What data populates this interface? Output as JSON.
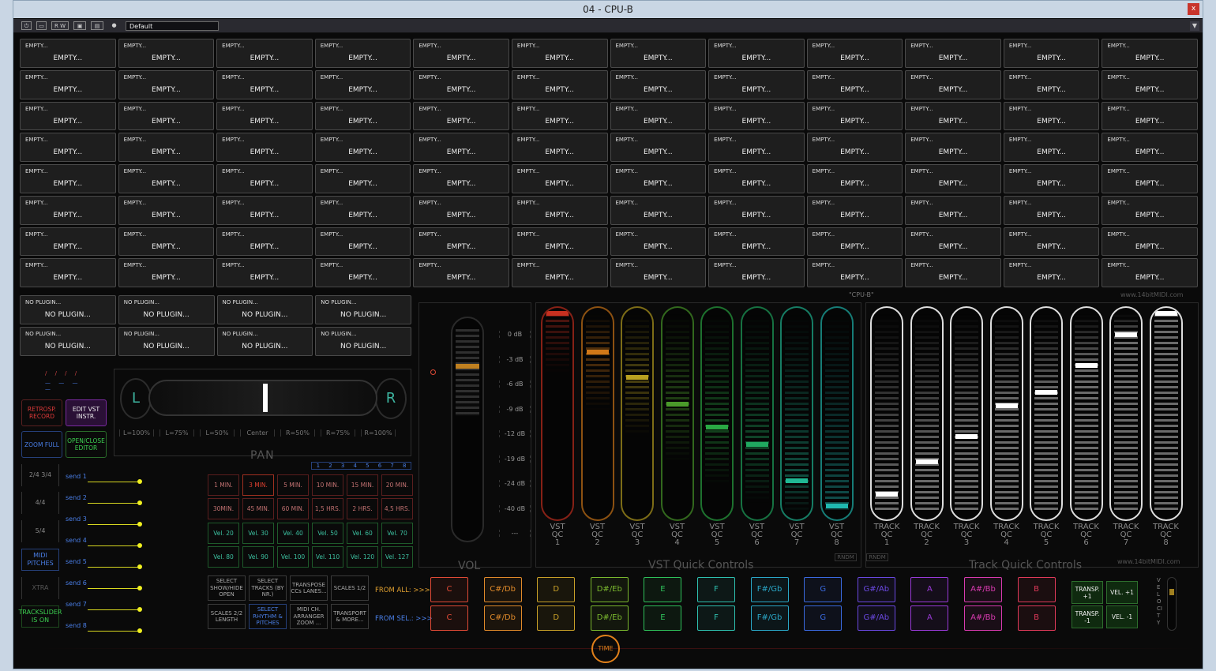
{
  "window": {
    "title": "04 - CPU-B",
    "close_label": "x"
  },
  "toolbar": {
    "buttons": [
      "⏻",
      "▭",
      "R W",
      "▣",
      "▤",
      "●"
    ],
    "preset": "Default"
  },
  "slots": {
    "top": "EMPTY...",
    "main": "EMPTY..."
  },
  "plugins": {
    "top": "NO PLUGIN...",
    "main": "NO PLUGIN..."
  },
  "left_buttons": {
    "retrosp": "RETROSP. RECORD",
    "edit_vst": "EDIT VST INSTR.",
    "zoom": "ZOOM FULL",
    "open_close": "OPEN/CLOSE EDITOR"
  },
  "pan": {
    "title": "PAN",
    "left": "L",
    "right": "R",
    "labels": [
      "L=100%",
      "L=75%",
      "L=50%",
      "Center",
      "R=50%",
      "R=75%",
      "R=100%"
    ]
  },
  "signatures": [
    "2/4 3/4",
    "4/4",
    "5/4",
    "MIDI PITCHES",
    "XTRA",
    "TRACKSLIDER IS ON"
  ],
  "sends": [
    "send 1",
    "send 2",
    "send 3",
    "send 4",
    "send 5",
    "send 6",
    "send 7",
    "send 8"
  ],
  "page_numbers": [
    "1",
    "2",
    "3",
    "4",
    "5",
    "6",
    "7",
    "8"
  ],
  "time_buttons": [
    "1 MIN.",
    "3 MIN.",
    "5 MIN.",
    "10 MIN.",
    "15 MIN.",
    "20 MIN.",
    "30MIN.",
    "45 MIN.",
    "60 MIN.",
    "1,5 HRS.",
    "2 HRS.",
    "4,5 HRS."
  ],
  "vel_buttons": [
    "Vel. 20",
    "Vel. 30",
    "Vel. 40",
    "Vel. 50",
    "Vel. 60",
    "Vel. 70",
    "Vel. 80",
    "Vel. 90",
    "Vel. 100",
    "Vel. 110",
    "Vel. 120",
    "Vel. 127"
  ],
  "functions": [
    "SELECT SHOW/HIDE OPEN",
    "SELECT TRACKS (BY NR.)",
    "TRANSPOSE CCs LANES...",
    "SCALES 1/2",
    "SCALES 2/2 LENGTH",
    "SELECT RHYTHM & PITCHES",
    "MIDI CH. ARRANGER ZOOM ...",
    "TRANSPORT & MORE..."
  ],
  "notes": {
    "from_all": "FROM ALL: >>>",
    "from_sel": "FROM SEL.: >>>",
    "names": [
      "C",
      "C#/Db",
      "D",
      "D#/Eb",
      "E",
      "F",
      "F#/Gb",
      "G",
      "G#/Ab",
      "A",
      "A#/Bb",
      "B"
    ],
    "colors": [
      "#e04a36",
      "#e08a2a",
      "#c8a028",
      "#7ab82e",
      "#2ec05a",
      "#2ec0b0",
      "#2aa8c8",
      "#3a6ae0",
      "#6a48e0",
      "#9a3ad8",
      "#d83ab0",
      "#e03a5a"
    ]
  },
  "transpose": {
    "t_up": "TRANSP. +1",
    "v_up": "VEL. +1",
    "t_down": "TRANSP. -1",
    "v_down": "VEL. -1",
    "velocity": "VELOCITY"
  },
  "volume": {
    "title": "VOL",
    "db_scale": [
      "0 dB",
      "-3 dB",
      "-6 dB",
      "-9 dB",
      "-12 dB",
      "-19 dB",
      "-24 dB",
      "-40 dB",
      "---"
    ]
  },
  "vst_qc": {
    "title": "VST Quick Controls",
    "labels": [
      "VST",
      "QC"
    ],
    "rndm": "RNDM",
    "levels": [
      1.0,
      0.8,
      0.67,
      0.53,
      0.41,
      0.32,
      0.13,
      0.0
    ],
    "colors": [
      "#c83020",
      "#d07818",
      "#b8a020",
      "#4a9a2a",
      "#2aa844",
      "#20a860",
      "#20b894",
      "#20b8b0"
    ]
  },
  "track_qc": {
    "title": "Track Quick Controls",
    "labels": [
      "TRACK",
      "QC"
    ],
    "rndm": "RNDM",
    "levels": [
      0.06,
      0.23,
      0.36,
      0.52,
      0.59,
      0.73,
      0.89,
      1.0
    ]
  },
  "header_right": {
    "cpu_label": "\"CPU-B\"",
    "site": "www.14bitMIDI.com"
  },
  "time_label": "TIME"
}
